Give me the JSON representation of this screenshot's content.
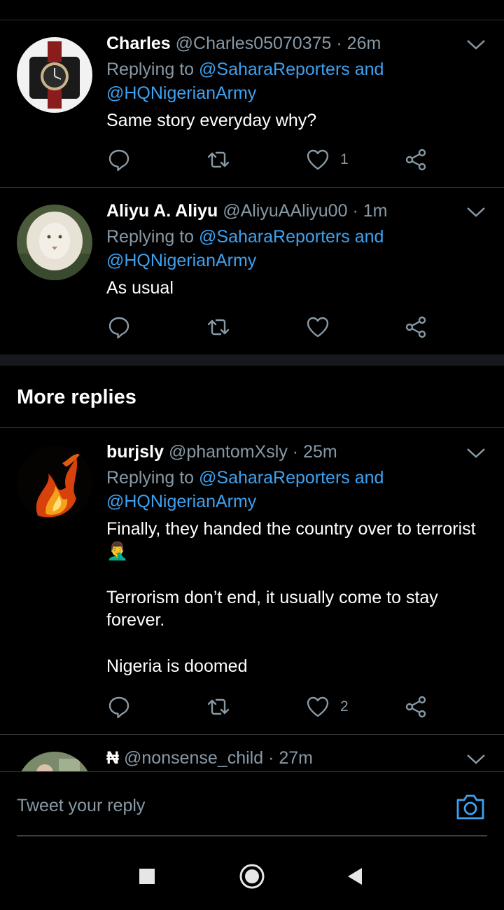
{
  "tweets": [
    {
      "name": "Charles",
      "handle": "@Charles05070375",
      "time": "26m",
      "replying_prefix": "Replying to",
      "mention1": "@SaharaReporters and",
      "mention2": "@HQNigerianArmy",
      "text": "Same story everyday why?",
      "likes": "1",
      "avatar": "watch-avatar"
    },
    {
      "name": "Aliyu A. Aliyu",
      "handle": "@AliyuAAliyu00",
      "time": "1m",
      "replying_prefix": "Replying to",
      "mention1": "@SaharaReporters and",
      "mention2": "@HQNigerianArmy",
      "text": "As usual",
      "likes": "",
      "avatar": "lion-avatar"
    }
  ],
  "more_replies": {
    "title": "More replies",
    "tweets": [
      {
        "name": "burjsly",
        "handle": "@phantomXsly",
        "time": "25m",
        "replying_prefix": "Replying to",
        "mention1": "@SaharaReporters and",
        "mention2": "@HQNigerianArmy",
        "text_line1": "Finally, they handed the country over to terrorist",
        "emoji": "🤦‍♂️",
        "text_para2_line1": "Terrorism don’t end, it usually come to stay",
        "text_para2_line2": "forever.",
        "text_para3": "Nigeria is doomed",
        "likes": "2",
        "avatar": "flame-avatar"
      },
      {
        "name": "₦",
        "handle": "@nonsense_child",
        "time": "27m",
        "avatar": "partial-avatar"
      }
    ]
  },
  "reply_bar": {
    "placeholder": "Tweet your reply",
    "camera_icon": "camera-icon"
  },
  "separator": "·",
  "colors": {
    "background": "#000000",
    "muted": "#8899a6",
    "link": "#3ea2f1",
    "divider": "#2f3336"
  }
}
